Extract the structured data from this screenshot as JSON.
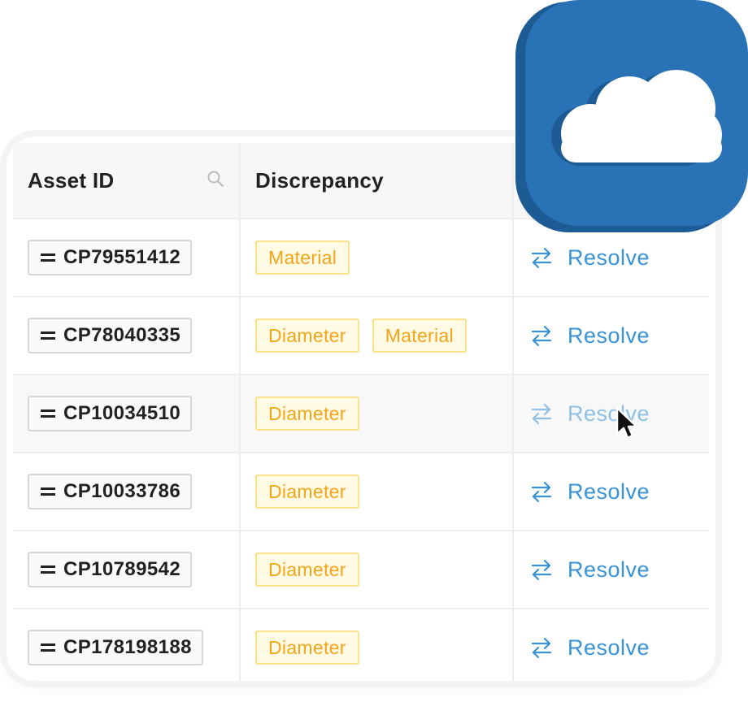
{
  "table": {
    "headers": {
      "asset_id": "Asset ID",
      "discrepancy": "Discrepancy"
    },
    "rows": [
      {
        "asset_id": "CP79551412",
        "tags": [
          "Material"
        ],
        "action": "Resolve"
      },
      {
        "asset_id": "CP78040335",
        "tags": [
          "Diameter",
          "Material"
        ],
        "action": "Resolve"
      },
      {
        "asset_id": "CP10034510",
        "tags": [
          "Diameter"
        ],
        "action": "Resolve",
        "hovered": true
      },
      {
        "asset_id": "CP10033786",
        "tags": [
          "Diameter"
        ],
        "action": "Resolve"
      },
      {
        "asset_id": "CP10789542",
        "tags": [
          "Diameter"
        ],
        "action": "Resolve"
      },
      {
        "asset_id": "CP178198188",
        "tags": [
          "Diameter"
        ],
        "action": "Resolve"
      }
    ]
  },
  "icons": {
    "header_search": "search-icon",
    "row_handle": "drag-handle-icon",
    "resolve": "swap-arrows-icon",
    "badge": "cloud-icon",
    "pointer": "mouse-cursor-icon"
  },
  "colors": {
    "badge_blue": "#2872b5",
    "badge_blue_dark": "#1d5b95",
    "resolve_blue": "#3892d8",
    "tag_text": "#f5a417",
    "tag_bg": "#fffbe5",
    "tag_border": "#fbe28a"
  }
}
